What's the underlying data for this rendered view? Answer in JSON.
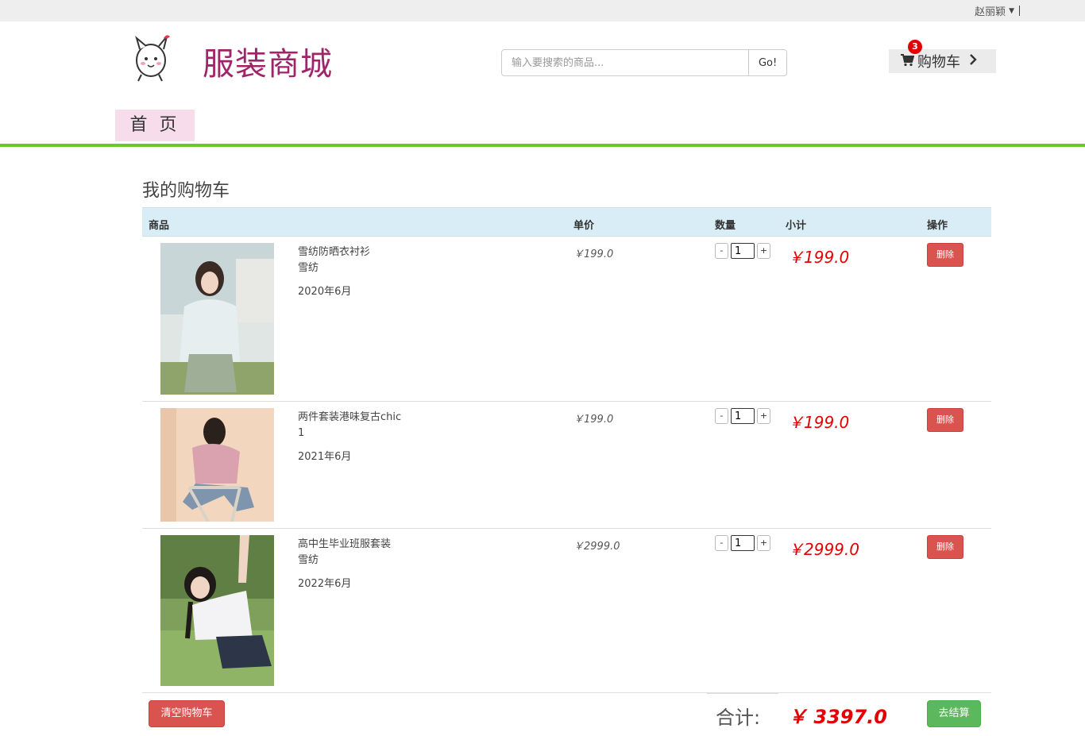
{
  "topbar": {
    "username": "赵丽颖"
  },
  "header": {
    "brand": "服装商城",
    "search_placeholder": "输入要搜索的商品...",
    "search_button": "Go!",
    "cart_label": "购物车",
    "cart_count": "3"
  },
  "nav": {
    "home": "首 页"
  },
  "cart": {
    "title": "我的购物车",
    "columns": {
      "product": "商品",
      "price": "单价",
      "quantity": "数量",
      "subtotal": "小计",
      "action": "操作"
    },
    "items": [
      {
        "name": "雪纺防晒衣衬衫",
        "material": "雪纺",
        "date": "2020年6月",
        "price": "￥199.0",
        "qty": "1",
        "subtotal": "￥199.0",
        "delete": "删除"
      },
      {
        "name": "两件套装港味复古chic",
        "material": "1",
        "date": "2021年6月",
        "price": "￥199.0",
        "qty": "1",
        "subtotal": "￥199.0",
        "delete": "删除"
      },
      {
        "name": "高中生毕业班服套装",
        "material": "雪纺",
        "date": "2022年6月",
        "price": "￥2999.0",
        "qty": "1",
        "subtotal": "￥2999.0",
        "delete": "删除"
      }
    ],
    "qty_minus": "-",
    "qty_plus": "+",
    "clear_button": "清空购物车",
    "total_label": "合计:",
    "total_value": "￥ 3397.0",
    "checkout_button": "去结算"
  },
  "colors": {
    "brand": "#a0246a",
    "accent_green": "#6ac72c",
    "price_red": "#e40000",
    "header_row": "#d9edf7"
  }
}
